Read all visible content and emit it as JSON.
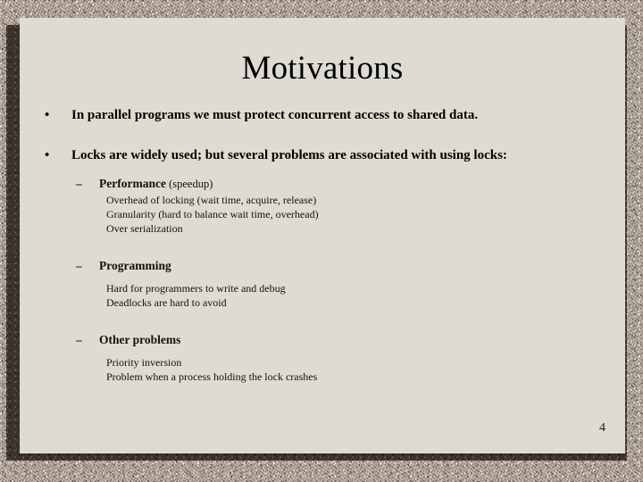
{
  "slide": {
    "title": "Motivations",
    "page_number": "4",
    "background_color": "#dedcd2",
    "texture_color": "#b3a498",
    "shadow_color": "#3b332c",
    "text_color": "#000000"
  },
  "bullets": {
    "bullet_mark": "•",
    "dash_mark": "–",
    "level1": [
      {
        "text": "In parallel programs we must protect concurrent access to shared data."
      },
      {
        "text": "Locks are widely used; but several problems are associated with using locks:"
      }
    ]
  },
  "sections": [
    {
      "heading": "Performance",
      "heading_suffix": " (speedup)",
      "items": [
        "Overhead of locking (wait time, acquire, release)",
        "Granularity (hard to balance wait time, overhead)",
        "Over serialization"
      ]
    },
    {
      "heading": "Programming",
      "heading_suffix": "",
      "items": [
        "Hard for programmers to write and debug",
        "Deadlocks are hard to avoid"
      ]
    },
    {
      "heading": "Other problems",
      "heading_suffix": "",
      "items": [
        "Priority inversion",
        "Problem when a process holding the lock crashes"
      ]
    }
  ]
}
